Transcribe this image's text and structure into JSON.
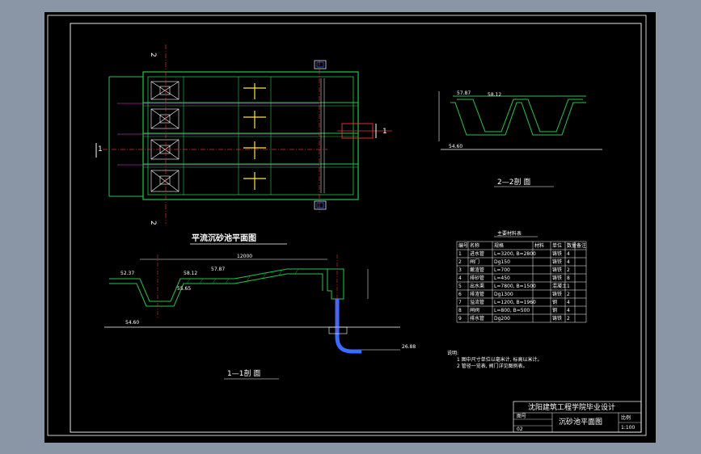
{
  "colors": {
    "background_window": "#8a95a5",
    "canvas": "#000000",
    "frame": "#ffffff",
    "structure_green": "#22c84a",
    "centerline_red": "#e03030",
    "pipe_blue": "#3a6cff",
    "gate_yellow": "#ffe24a",
    "accent_magenta": "#ff30ff",
    "text_white": "#ffffff"
  },
  "plan_view": {
    "title": "平流沉砂池平面图",
    "section_marks": {
      "one_left": "1",
      "one_right": "1",
      "two_top": "2",
      "two_bottom": "2"
    }
  },
  "section_1_1": {
    "title": "1—1剖 面",
    "elevations": [
      "52.37",
      "58.12",
      "57.87",
      "55.65",
      "54.60",
      "26.88"
    ],
    "length_label": "12000"
  },
  "section_2_2": {
    "title": "2—2剖 面",
    "elevations": [
      "57.87",
      "58.12",
      "54.60"
    ]
  },
  "materials_table": {
    "title": "主要材料表",
    "headers": [
      "编号",
      "名称",
      "规格",
      "材料",
      "单位",
      "数量",
      "备注"
    ],
    "rows": [
      [
        "1",
        "进水管",
        "L=3200, B=2800",
        "",
        "铸铁",
        "4",
        ""
      ],
      [
        "2",
        "闸门",
        "Dg150",
        "",
        "铸铁",
        "4",
        ""
      ],
      [
        "3",
        "撇渣管",
        "L=700",
        "",
        "铸铁",
        "2",
        ""
      ],
      [
        "4",
        "排砂管",
        "L=450",
        "",
        "铸铁",
        "8",
        ""
      ],
      [
        "5",
        "出水渠",
        "L=7800, B=1500",
        "",
        "混凝土",
        "1",
        ""
      ],
      [
        "6",
        "排渣管",
        "Dg1300",
        "",
        "铸铁",
        "2",
        ""
      ],
      [
        "7",
        "溢流管",
        "L=1200, B=1960",
        "",
        "钢",
        "4",
        ""
      ],
      [
        "8",
        "闸阀",
        "L=800, B=500",
        "",
        "钢",
        "4",
        ""
      ],
      [
        "9",
        "排水管",
        "Dg200",
        "",
        "铸铁",
        "2",
        ""
      ]
    ]
  },
  "notes": {
    "heading": "说明:",
    "lines": [
      "1  图中尺寸单位以毫米计, 标高以米计。",
      "2  管径一览表, 阀门详见图例表。"
    ]
  },
  "title_block": {
    "institution": "沈阳建筑工程学院毕业设计",
    "drawing_name": "沉砂池平面图",
    "scale_label": "比例",
    "drawing_no_label": "图号",
    "scale_value": "1:100",
    "sheet_value": "02"
  }
}
